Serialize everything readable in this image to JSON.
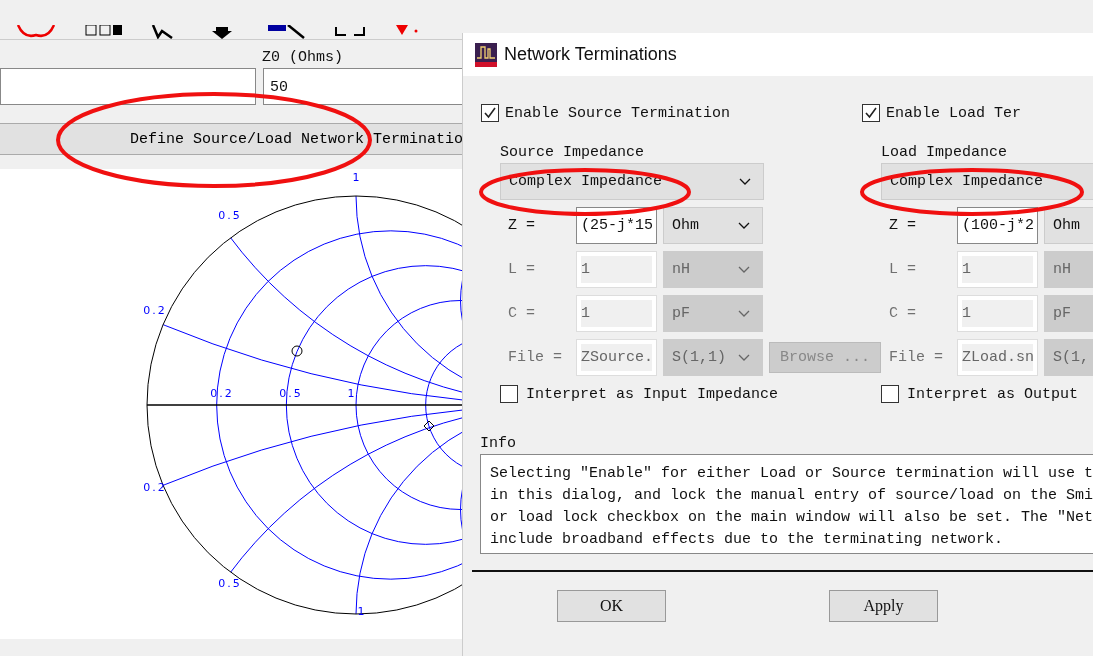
{
  "main": {
    "z0": {
      "label": "Z0 (Ohms)",
      "value": "50"
    },
    "define_button": "Define Source/Load Network Terminatio",
    "chart": {
      "upper_labels": [
        "1",
        "0.5",
        "0.2"
      ],
      "axis_labels": [
        "0.2",
        "0.5",
        "1"
      ],
      "lower_labels": [
        "0.2",
        "0.5",
        "1"
      ]
    }
  },
  "dialog": {
    "title": "Network Terminations",
    "panels": [
      {
        "enable": {
          "label": "Enable Source Termination",
          "checked": true
        },
        "heading": "Source Impedance",
        "type": "Complex Impedance",
        "rows": [
          {
            "label": "Z =",
            "value": "(25-j*15",
            "unit": "Ohm",
            "disabled": false
          },
          {
            "label": "L =",
            "value": "1",
            "unit": "nH",
            "disabled": true
          },
          {
            "label": "C =",
            "value": "1",
            "unit": "pF",
            "disabled": true
          },
          {
            "label": "File =",
            "value": "ZSource.",
            "unit": "S(1,1)",
            "disabled": true,
            "button": "Browse ..."
          }
        ],
        "interpret": {
          "label": "Interpret as Input Impedance",
          "checked": false
        }
      },
      {
        "enable": {
          "label": "Enable Load Ter",
          "checked": true
        },
        "heading": "Load Impedance",
        "type": "Complex Impedance",
        "rows": [
          {
            "label": "Z =",
            "value": "(100-j*2",
            "unit": "Ohm",
            "disabled": false
          },
          {
            "label": "L =",
            "value": "1",
            "unit": "nH",
            "disabled": true
          },
          {
            "label": "C =",
            "value": "1",
            "unit": "pF",
            "disabled": true
          },
          {
            "label": "File =",
            "value": "ZLoad.sn",
            "unit": "S(1,",
            "disabled": true
          }
        ],
        "interpret": {
          "label": "Interpret as Output",
          "checked": false
        }
      }
    ],
    "info": {
      "label": "Info",
      "lines": [
        "Selecting \"Enable\" for either Load or Source termination will use t",
        "in this dialog, and lock the manual entry of source/load on the Smi",
        "or load lock checkbox on the main window will also be set. The \"Net",
        "include broadband effects due to the terminating network."
      ]
    },
    "buttons": [
      "OK",
      "Apply"
    ]
  }
}
